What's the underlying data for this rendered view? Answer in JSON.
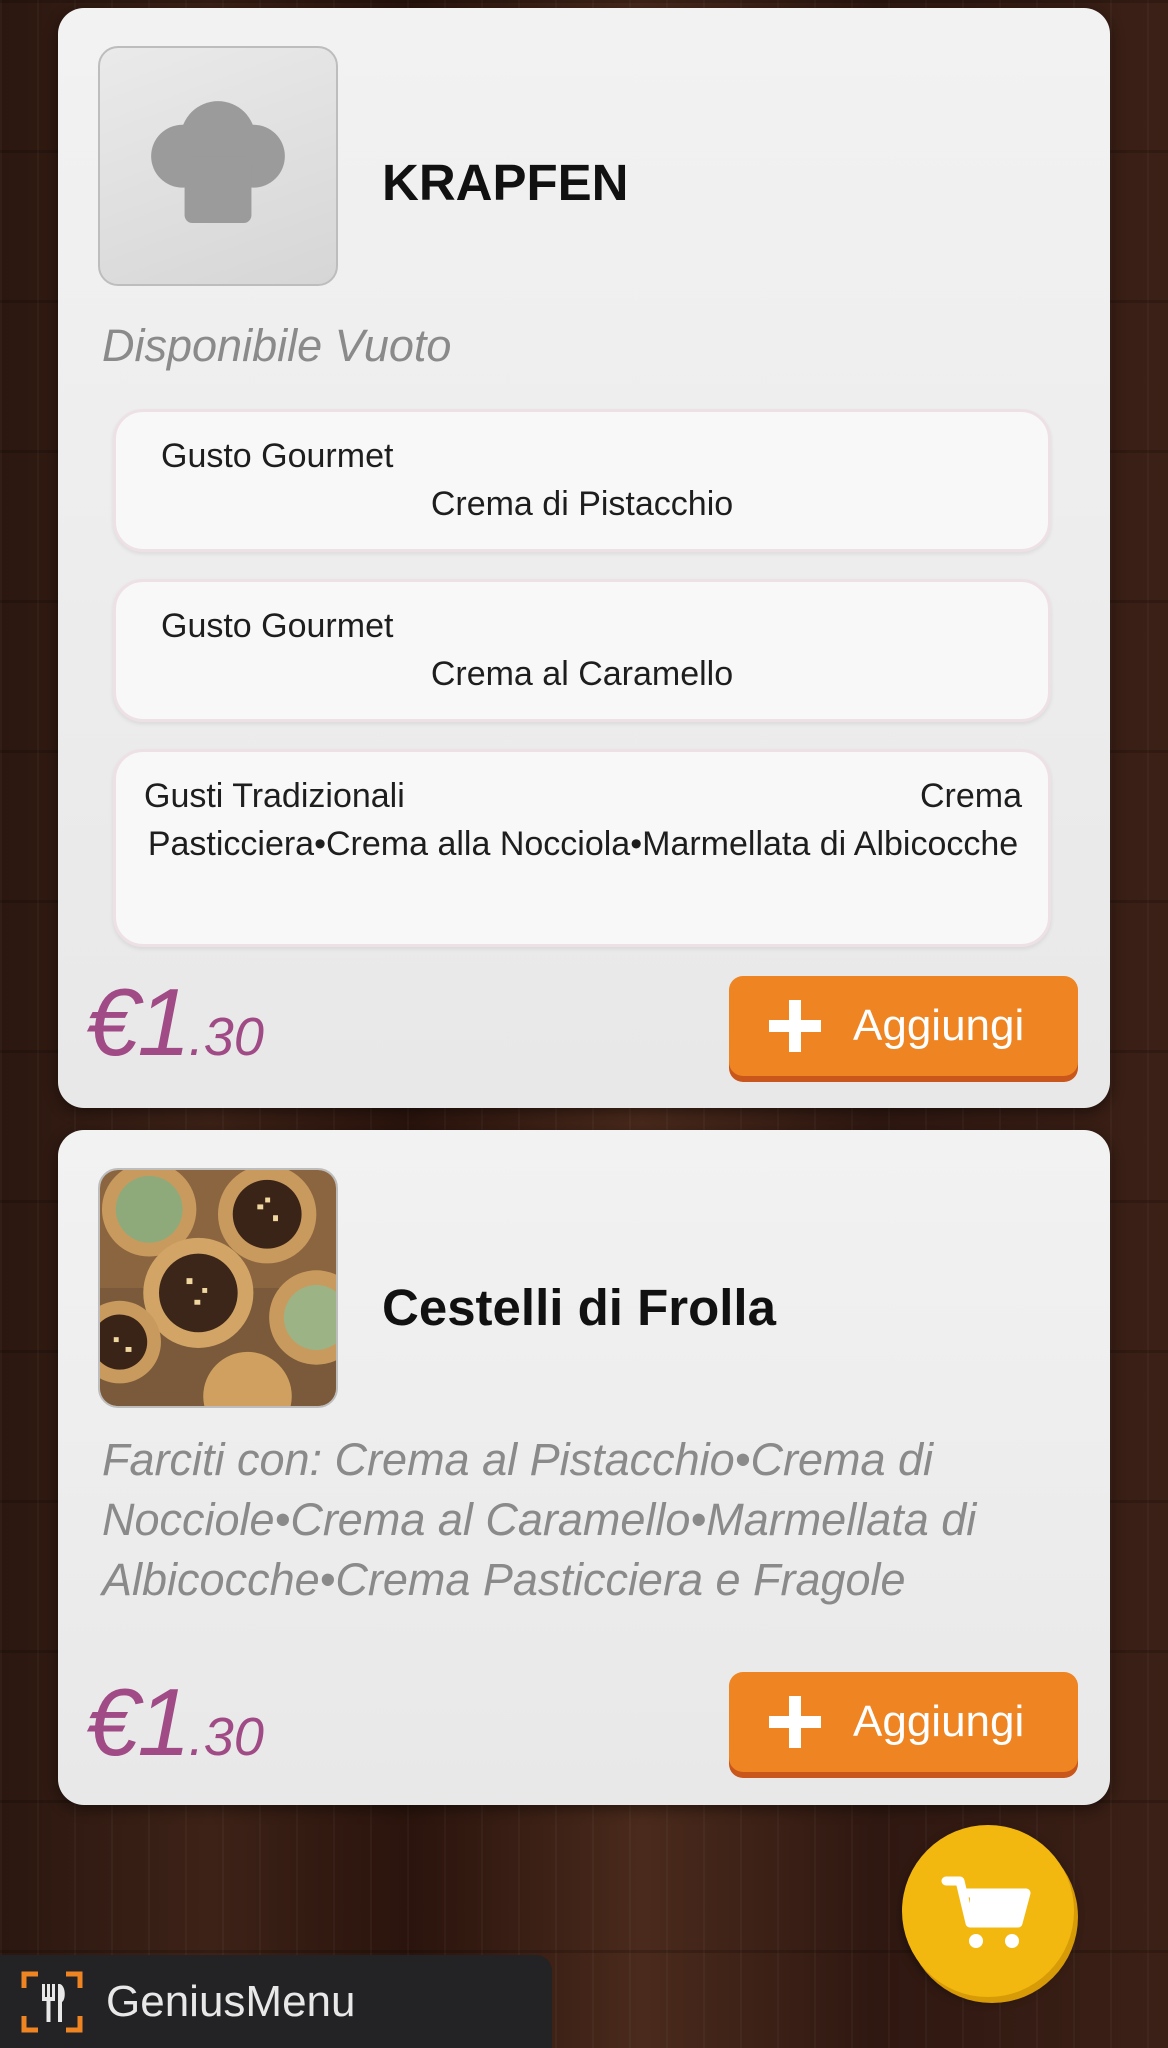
{
  "products": [
    {
      "title": "KRAPFEN",
      "subtitle": "Disponibile Vuoto",
      "image_icon": "chef-hat-icon",
      "options": [
        {
          "label": "Gusto Gourmet",
          "value": "Crema di Pistacchio"
        },
        {
          "label": "Gusto Gourmet",
          "value": "Crema al Caramello"
        },
        {
          "label": "Gusti Tradizionali",
          "value_first": "Crema",
          "value_rest": "Pasticciera•Crema alla Nocciola•Marmellata di Albicocche"
        }
      ],
      "price": {
        "currency_int": "€1",
        "decimals": ".30"
      },
      "add_label": "Aggiungi"
    },
    {
      "title": "Cestelli di Frolla",
      "description": "Farciti con: Crema al Pistacchio•Crema di Nocciole•Crema al Caramello•Marmellata di Albicocche•Crema Pasticciera e Fragole",
      "image_icon": "tart-photo",
      "price": {
        "currency_int": "€1",
        "decimals": ".30"
      },
      "add_label": "Aggiungi"
    }
  ],
  "cart": {
    "icon": "shopping-cart-icon"
  },
  "brand": {
    "name": "GeniusMenu",
    "icon": "fork-knife-icon"
  },
  "colors": {
    "accent_orange": "#ef8422",
    "price_purple": "#a04a86",
    "cart_yellow": "#f3b80f",
    "brand_bar": "#232225"
  }
}
